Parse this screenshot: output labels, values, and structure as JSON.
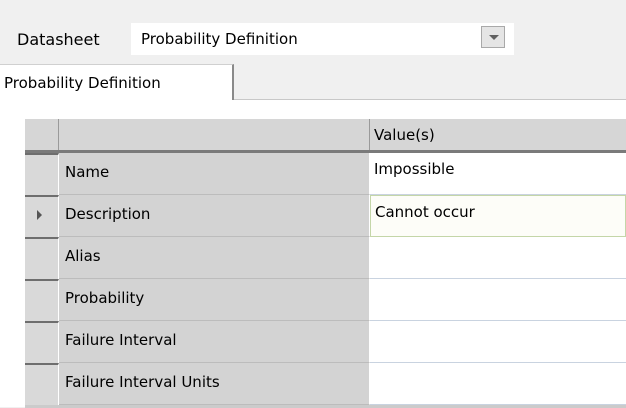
{
  "datasheet": {
    "label": "Datasheet",
    "selected": "Probability Definition"
  },
  "tabs": [
    {
      "label": "Probability Definition",
      "active": true
    }
  ],
  "grid": {
    "columns": [
      "",
      "Value(s)"
    ],
    "rows": [
      {
        "name": "Name",
        "value": "Impossible",
        "current": false
      },
      {
        "name": "Description",
        "value": "Cannot occur",
        "current": true
      },
      {
        "name": "Alias",
        "value": "",
        "current": false
      },
      {
        "name": "Probability",
        "value": "",
        "current": false
      },
      {
        "name": "Failure Interval",
        "value": "",
        "current": false
      },
      {
        "name": "Failure Interval Units",
        "value": "",
        "current": false
      }
    ]
  },
  "icons": {
    "dropdown": "chevron-down-icon",
    "current_row": "row-pointer-icon"
  }
}
